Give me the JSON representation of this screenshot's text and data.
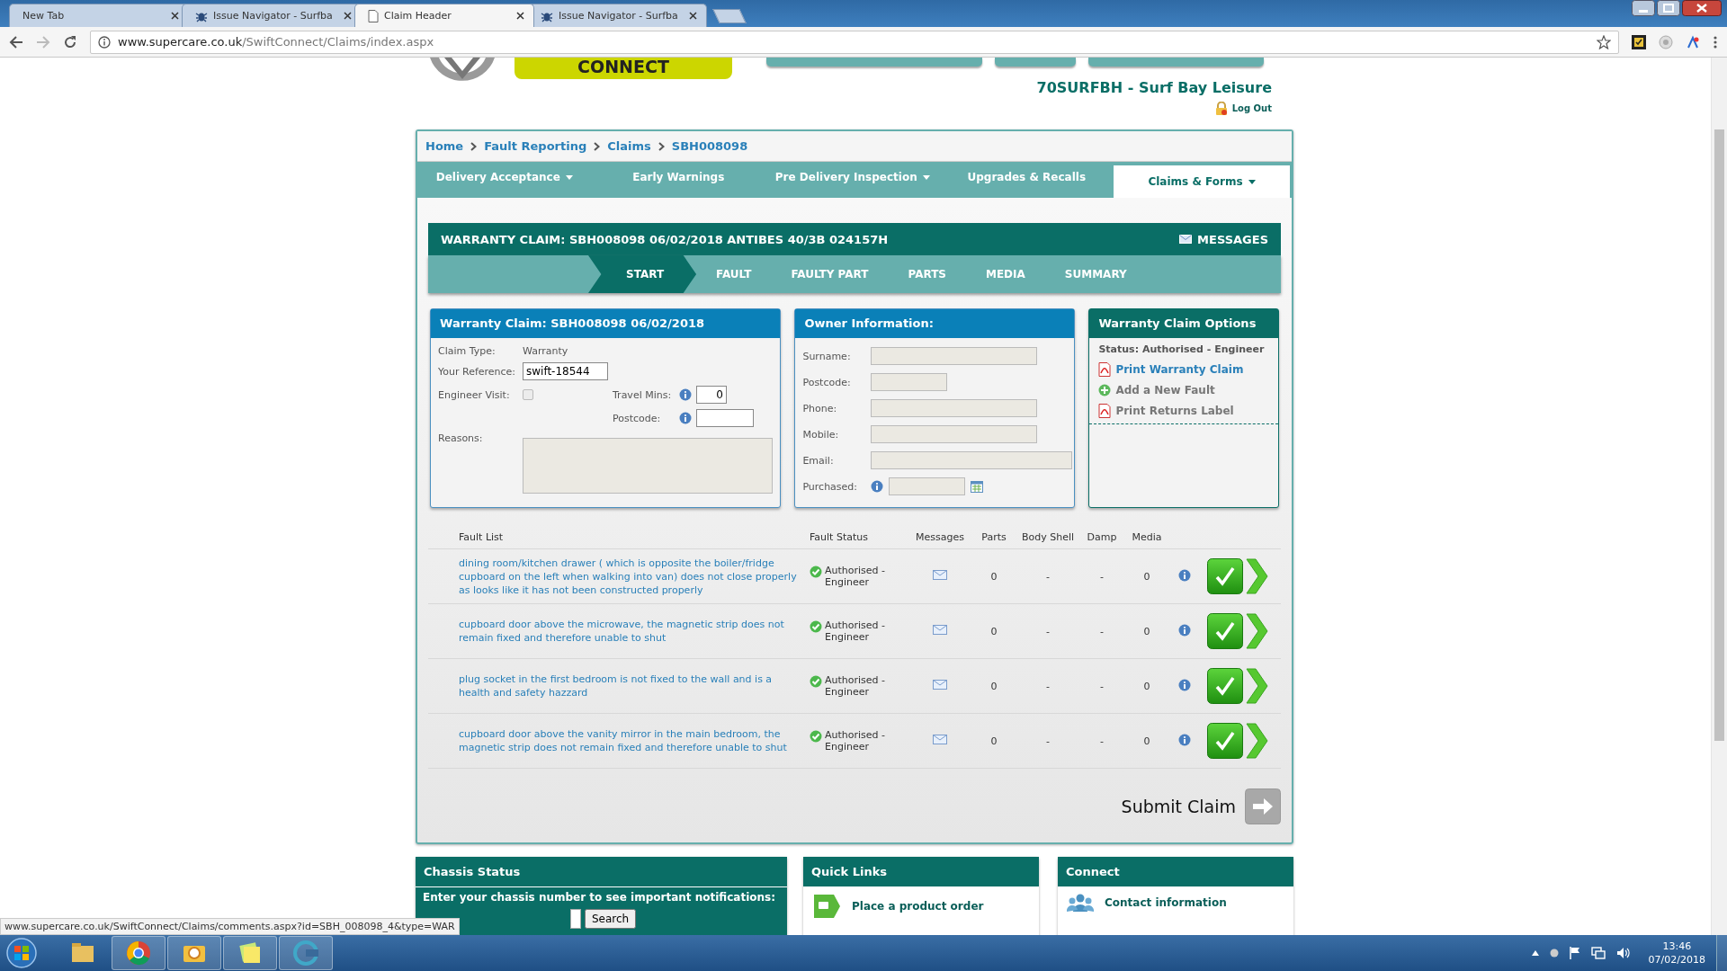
{
  "browser": {
    "tabs": [
      {
        "title": "New Tab",
        "selected": false,
        "kind": "blank"
      },
      {
        "title": "Issue Navigator - Surfba",
        "selected": false,
        "kind": "bug"
      },
      {
        "title": "Claim Header",
        "selected": true,
        "kind": "page"
      },
      {
        "title": "Issue Navigator - Surfba",
        "selected": false,
        "kind": "bug"
      }
    ],
    "url_host": "www.supercare.co.uk",
    "url_path": "/SwiftConnect/Claims/index.aspx"
  },
  "header": {
    "logo_text": "CONNECT",
    "dealer": "70SURFBH - Surf Bay Leisure",
    "logout": "Log Out"
  },
  "breadcrumbs": [
    "Home",
    "Fault Reporting",
    "Claims",
    "SBH008098"
  ],
  "nav": [
    {
      "label": "Delivery Acceptance",
      "dropdown": true,
      "selected": false
    },
    {
      "label": "Early Warnings",
      "dropdown": false,
      "selected": false
    },
    {
      "label": "Pre Delivery Inspection",
      "dropdown": true,
      "selected": false
    },
    {
      "label": "Upgrades & Recalls",
      "dropdown": false,
      "selected": false
    },
    {
      "label": "Claims & Forms",
      "dropdown": true,
      "selected": true
    }
  ],
  "claim": {
    "title": "WARRANTY CLAIM: SBH008098 06/02/2018 ANTIBES 40/3B 024157H",
    "messages": "MESSAGES"
  },
  "steps": [
    {
      "label": "START",
      "selected": true
    },
    {
      "label": "FAULT",
      "selected": false
    },
    {
      "label": "FAULTY PART",
      "selected": false
    },
    {
      "label": "PARTS",
      "selected": false
    },
    {
      "label": "MEDIA",
      "selected": false
    },
    {
      "label": "SUMMARY",
      "selected": false
    }
  ],
  "claim_panel": {
    "title": "Warranty Claim: SBH008098 06/02/2018",
    "claim_type_label": "Claim Type:",
    "claim_type": "Warranty",
    "reference_label": "Your Reference:",
    "reference": "swift-18544",
    "engineer_visit_label": "Engineer Visit:",
    "engineer_visit": {
      "checked": false,
      "disabled": true
    },
    "travel_mins_label": "Travel Mins:",
    "travel_mins": "0",
    "postcode_label": "Postcode:",
    "reasons_label": "Reasons:"
  },
  "owner_panel": {
    "title": "Owner Information:",
    "fields": [
      {
        "label": "Surname:",
        "kind": "medium"
      },
      {
        "label": "Postcode:",
        "kind": "short"
      },
      {
        "label": "Phone:",
        "kind": "medium"
      },
      {
        "label": "Mobile:",
        "kind": "medium"
      },
      {
        "label": "Email:",
        "kind": "long"
      },
      {
        "label": "Purchased:",
        "kind": "date"
      }
    ]
  },
  "options_panel": {
    "title": "Warranty Claim Options",
    "status": "Status: Authorised - Engineer",
    "links": [
      {
        "label": "Print Warranty Claim",
        "kind": "pdf",
        "disabled": false
      },
      {
        "label": "Add a New Fault",
        "kind": "add",
        "disabled": true
      },
      {
        "label": "Print Returns Label",
        "kind": "pdf",
        "disabled": true
      }
    ]
  },
  "fault_table": {
    "columns": [
      "Fault List",
      "Fault Status",
      "Messages",
      "Parts",
      "Body Shell",
      "Damp",
      "Media"
    ],
    "rows": [
      {
        "description": "dining room/kitchen drawer ( which is opposite the boiler/fridge cupboard on the left when walking into van) does not close properly as looks like it has not been constructed properly",
        "status": "Authorised - Engineer",
        "parts": "0",
        "body_shell": "-",
        "damp": "-",
        "media": "0"
      },
      {
        "description": "cupboard door above the microwave, the magnetic strip does not remain fixed and therefore unable to shut",
        "status": "Authorised - Engineer",
        "parts": "0",
        "body_shell": "-",
        "damp": "-",
        "media": "0"
      },
      {
        "description": "plug socket in the first bedroom is not fixed to the wall and is a health and safety hazzard",
        "status": "Authorised - Engineer",
        "parts": "0",
        "body_shell": "-",
        "damp": "-",
        "media": "0"
      },
      {
        "description": "cupboard door above the vanity mirror in the main bedroom, the magnetic strip does not remain fixed and therefore unable to shut",
        "status": "Authorised - Engineer",
        "parts": "0",
        "body_shell": "-",
        "damp": "-",
        "media": "0"
      }
    ]
  },
  "submit": "Submit Claim",
  "chassis_panel": {
    "title": "Chassis Status",
    "prompt": "Enter your chassis number to see important notifications:",
    "button": "Search"
  },
  "quick_links": {
    "title": "Quick Links",
    "items": [
      "Place a product order"
    ]
  },
  "connect_panel": {
    "title": "Connect",
    "items": [
      "Contact information"
    ]
  },
  "status_url": "www.supercare.co.uk/SwiftConnect/Claims/comments.aspx?id=SBH_008098_4&type=WAR",
  "taskbar": {
    "time": "13:46",
    "date": "07/02/2018"
  }
}
